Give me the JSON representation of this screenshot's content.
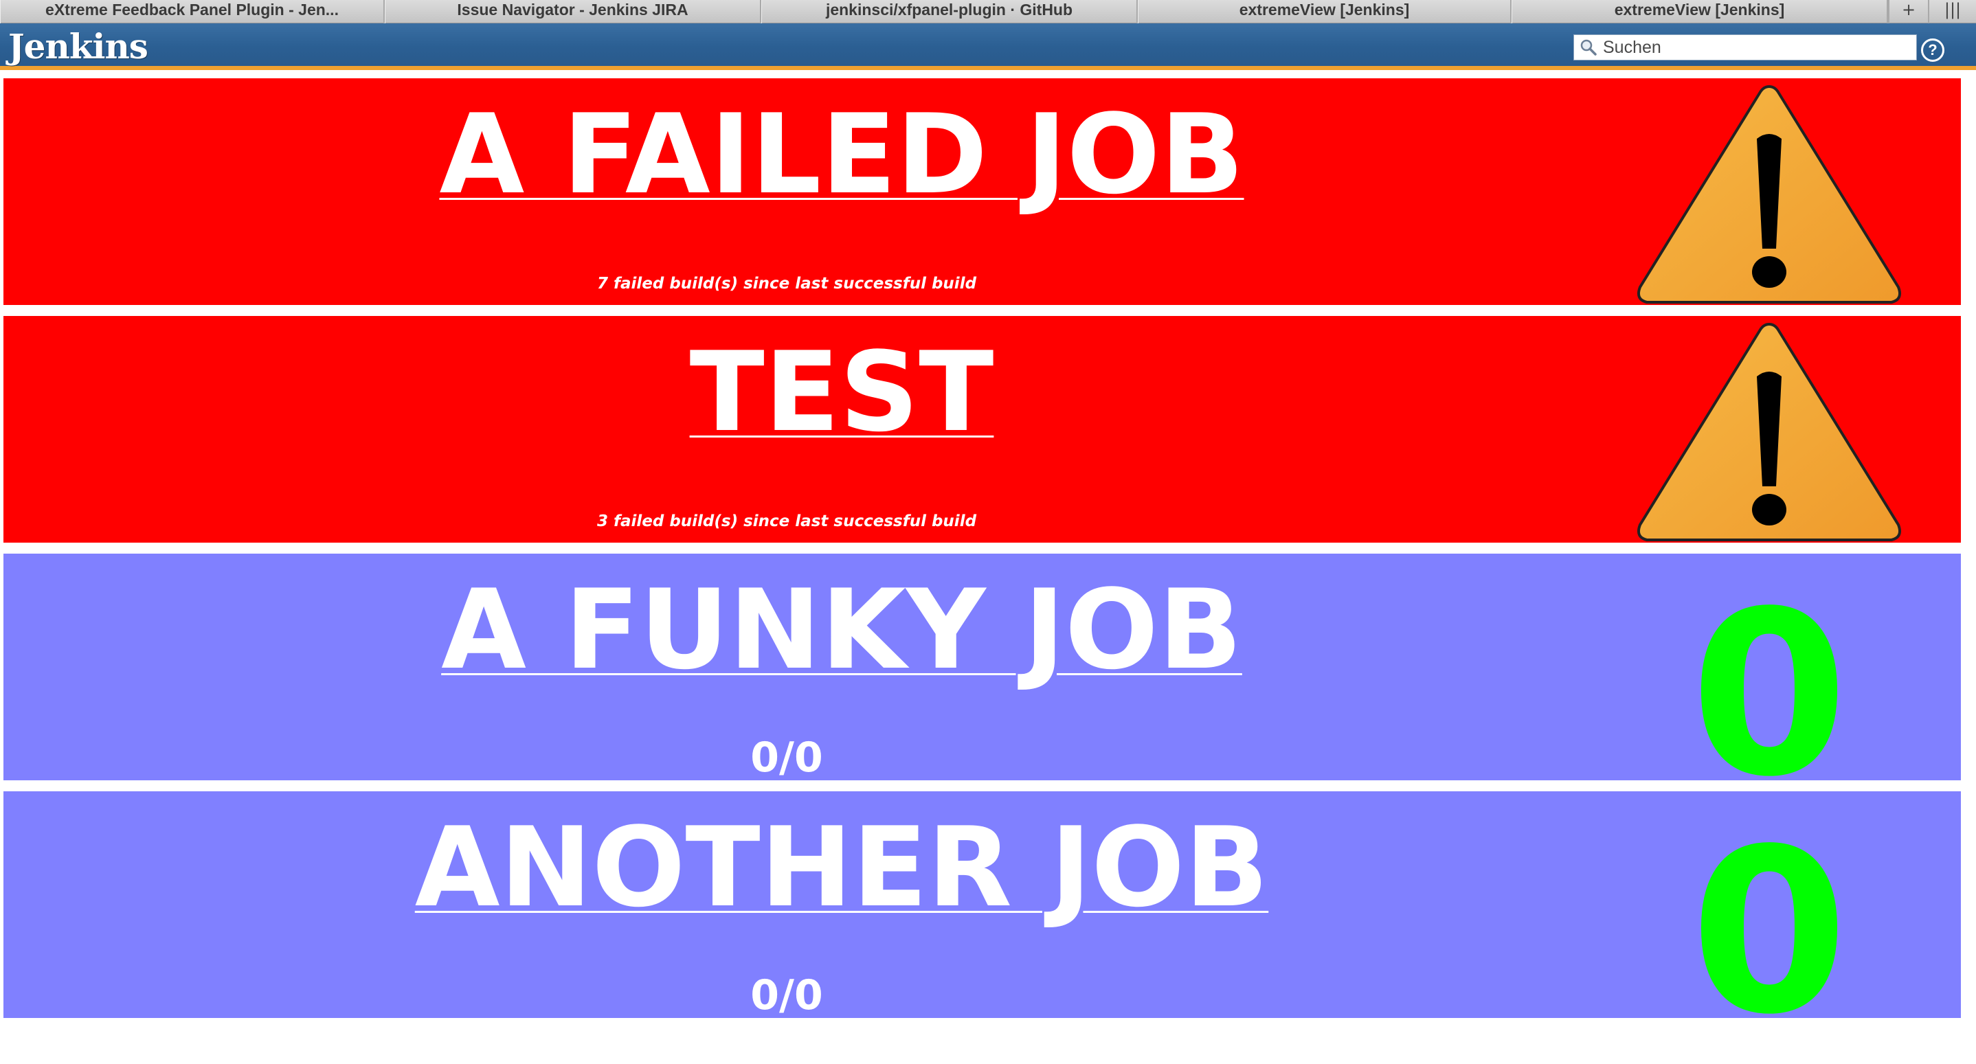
{
  "browser": {
    "tabs": [
      {
        "label": "eXtreme Feedback Panel Plugin - Jen..."
      },
      {
        "label": "Issue Navigator - Jenkins JIRA"
      },
      {
        "label": "jenkinsci/xfpanel-plugin · GitHub"
      },
      {
        "label": "extremeView [Jenkins]"
      },
      {
        "label": "extremeView [Jenkins]"
      }
    ],
    "new_tab_glyph": "+",
    "menu_glyph": "|||"
  },
  "header": {
    "logo": "Jenkins",
    "search_placeholder": "Suchen",
    "help_glyph": "?"
  },
  "colors": {
    "failed": "#ff0000",
    "stable": "#8080ff",
    "zero_count": "#00ff00",
    "warning_fill": "#f2a33a"
  },
  "jobs": [
    {
      "name": "A FAILED JOB",
      "status": "failed",
      "detail": "7 failed build(s) since last successful build",
      "icon": "warning-icon"
    },
    {
      "name": "TEST",
      "status": "failed",
      "detail": "3 failed build(s) since last successful build",
      "icon": "warning-icon"
    },
    {
      "name": "A FUNKY JOB",
      "status": "stable",
      "ratio": "0/0",
      "count": "0"
    },
    {
      "name": "ANOTHER JOB",
      "status": "stable",
      "ratio": "0/0",
      "count": "0"
    }
  ]
}
